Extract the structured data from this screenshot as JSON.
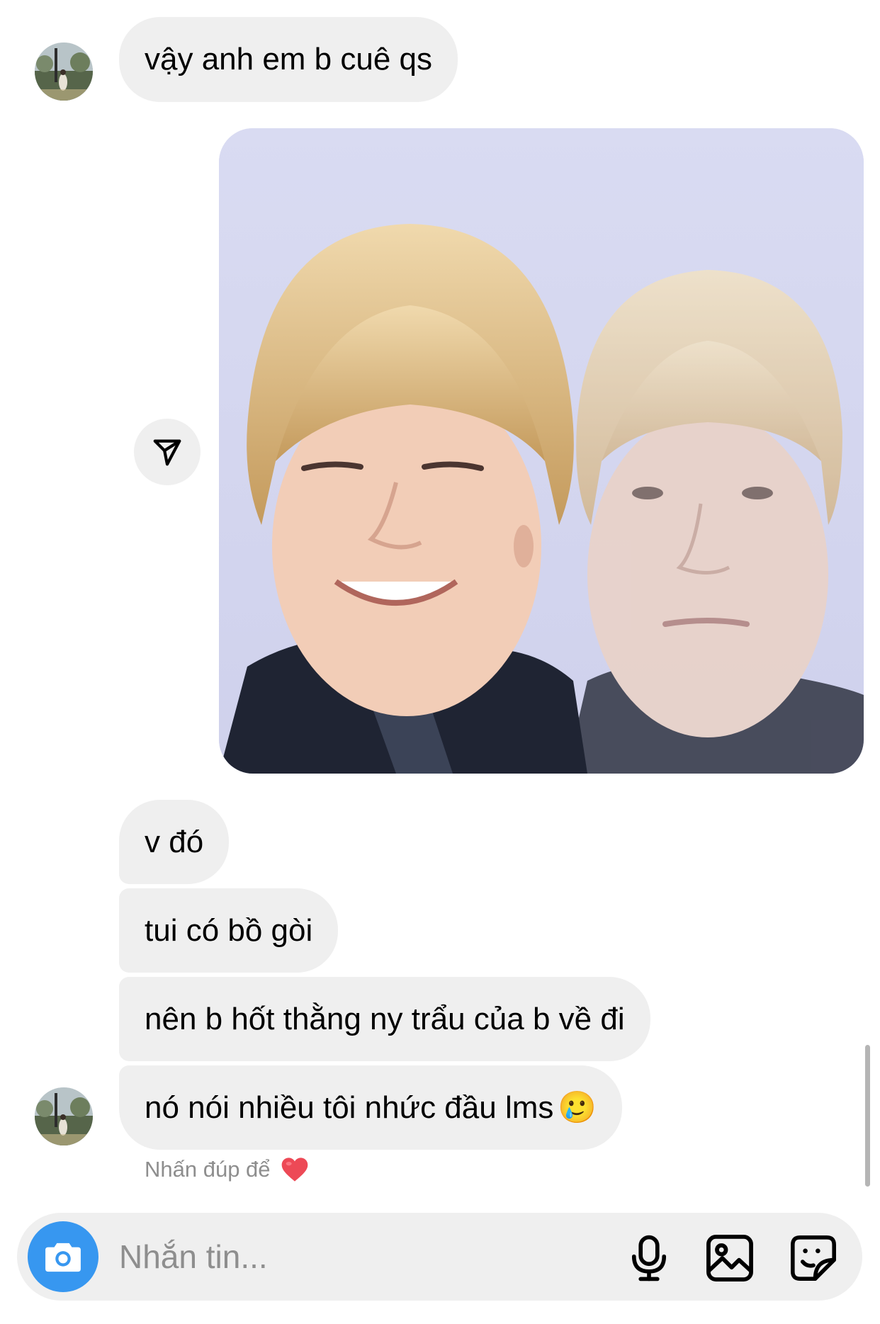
{
  "messages": [
    {
      "text": "vậy anh em b cuê qs"
    },
    {
      "text": "v đó"
    },
    {
      "text": "tui có bồ gòi"
    },
    {
      "text": "nên b hốt thằng ny trẩu của b về đi"
    },
    {
      "text": "nó nói nhiều tôi nhức đầu lms",
      "emoji": "🥲"
    }
  ],
  "reaction_hint": {
    "text": "Nhấn đúp để",
    "icon": "heart-icon",
    "color": "#ed4956"
  },
  "shared_photo": {
    "description_icon": "photo"
  },
  "composer": {
    "placeholder": "Nhắn tin...",
    "value": "",
    "camera_icon": "camera-icon",
    "tools": [
      "microphone-icon",
      "image-icon",
      "sticker-icon"
    ]
  },
  "colors": {
    "accent": "#3797f0",
    "bubble": "#efefef",
    "hint_text": "#8e8e8e"
  }
}
